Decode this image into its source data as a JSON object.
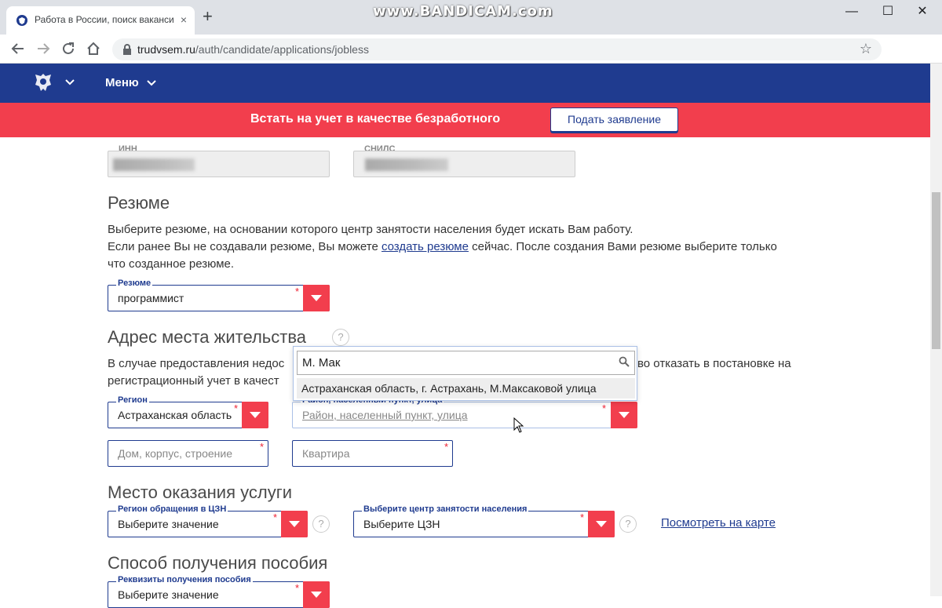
{
  "browser": {
    "tab_title": "Работа в России, поиск ваканси",
    "tab_close": "×",
    "new_tab": "+",
    "watermark": "www.BANDICAM.com",
    "window_controls": {
      "minimize": "—",
      "maximize": "☐",
      "close": "✕"
    },
    "url_domain": "trudvsem.ru",
    "url_path": "/auth/candidate/applications/jobless",
    "bookmark_star": "☆",
    "menu_dots": "⋮"
  },
  "header": {
    "menu_label": "Меню"
  },
  "banner": {
    "text": "Встать на учет в качестве безработного",
    "button": "Подать заявление",
    "color": "#f23e4d"
  },
  "ids": {
    "inn_label": "ИНН",
    "snils_label": "СНИЛС"
  },
  "resume": {
    "title": "Резюме",
    "line1": "Выберите резюме, на основании которого центр занятости населения будет искать Вам работу.",
    "line2_pre": "Если ранее Вы не создавали резюме, Вы можете ",
    "line2_link": "создать резюме",
    "line2_post": " сейчас. После создания Вами резюме выберите только",
    "line3": "что созданное резюме.",
    "field_label": "Резюме",
    "field_value": "программист",
    "required_mark": "*"
  },
  "address": {
    "title": "Адрес места жительства",
    "help": "?",
    "line1_pre": "В случае предоставления недос",
    "line1_post": "во отказать в постановке на",
    "line2_pre": "регистрационный учет в качест",
    "region_label": "Регион",
    "region_value": "Астраханская область",
    "district_label": "Район, населенный пункт, улица",
    "district_placeholder": "Район, населенный пункт, улица",
    "house_placeholder": "Дом, корпус, строение",
    "apt_placeholder": "Квартира"
  },
  "popup": {
    "search_value": "М. Мак",
    "option": "Астраханская область, г. Астрахань, М.Максаковой улица"
  },
  "service": {
    "title": "Место оказания услуги",
    "region_label": "Регион обращения в ЦЗН",
    "region_value": "Выберите значение",
    "center_label": "Выберите центр занятости населения",
    "center_value": "Выберите ЦЗН",
    "map_link": "Посмотреть на карте"
  },
  "benefit": {
    "title": "Способ получения пособия",
    "field_label": "Реквизиты получения пособия",
    "field_value": "Выберите значение"
  },
  "colors": {
    "header_blue": "#1f3b8f",
    "accent_red": "#f23e4d"
  }
}
